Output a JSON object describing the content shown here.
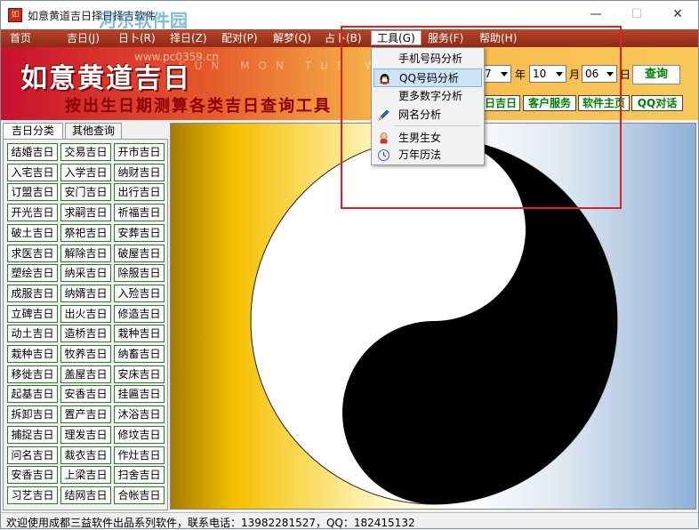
{
  "window": {
    "title": "如意黄道吉日择日择吉软件",
    "watermark": "河东软件园",
    "minimize": "—",
    "maximize": "☐",
    "close": "✕"
  },
  "menu": [
    {
      "label": "首页"
    },
    {
      "label": "吉日(J)"
    },
    {
      "label": "日卜(R)"
    },
    {
      "label": "择日(Z)"
    },
    {
      "label": "配对(P)"
    },
    {
      "label": "解梦(Q)"
    },
    {
      "label": "占卜(B)"
    },
    {
      "label": "工具(G)"
    },
    {
      "label": "服务(F)"
    },
    {
      "label": "帮助(H)"
    }
  ],
  "banner": {
    "title": "如意黄道吉日",
    "subtitle": "按出生日期测算各类吉日查询工具",
    "url": "www.pc0359.cn",
    "weekdays": "SUN MON TUE WED"
  },
  "date": {
    "year_value": "7",
    "year_label": "年",
    "month_value": "10",
    "month_label": "月",
    "day_value": "06",
    "day_label": "日",
    "query_button": "查询"
  },
  "links": {
    "jiri": "日吉日",
    "customer_service": "客户服务",
    "home": "软件主页",
    "qq": "QQ对话"
  },
  "tabs": {
    "jiri_category": "吉日分类",
    "other_query": "其他查询"
  },
  "jiri_buttons": [
    [
      "结婚吉日",
      "交易吉日",
      "开市吉日"
    ],
    [
      "入宅吉日",
      "入学吉日",
      "纳财吉日"
    ],
    [
      "订盟吉日",
      "安门吉日",
      "出行吉日"
    ],
    [
      "开光吉日",
      "求嗣吉日",
      "祈福吉日"
    ],
    [
      "破土吉日",
      "祭祀吉日",
      "安葬吉日"
    ],
    [
      "求医吉日",
      "解除吉日",
      "破屋吉日"
    ],
    [
      "塑绘吉日",
      "纳采吉日",
      "除服吉日"
    ],
    [
      "成服吉日",
      "纳婿吉日",
      "入殓吉日"
    ],
    [
      "立碑吉日",
      "出火吉日",
      "修造吉日"
    ],
    [
      "动土吉日",
      "造桥吉日",
      "栽种吉日"
    ],
    [
      "栽种吉日",
      "牧养吉日",
      "纳畜吉日"
    ],
    [
      "移徙吉日",
      "盖屋吉日",
      "安床吉日"
    ],
    [
      "起基吉日",
      "安香吉日",
      "挂匾吉日"
    ],
    [
      "拆卸吉日",
      "置产吉日",
      "沐浴吉日"
    ],
    [
      "捕捉吉日",
      "理发吉日",
      "修坟吉日"
    ],
    [
      "问名吉日",
      "裁衣吉日",
      "作灶吉日"
    ],
    [
      "安香吉日",
      "上梁吉日",
      "扫舍吉日"
    ],
    [
      "习艺吉日",
      "结网吉日",
      "合帐吉日"
    ]
  ],
  "tools_menu": {
    "items": [
      {
        "label": "手机号码分析",
        "icon": ""
      },
      {
        "label": "QQ号码分析",
        "icon": "qq-penguin-icon"
      },
      {
        "label": "更多数字分析",
        "icon": ""
      },
      {
        "label": "网名分析",
        "icon": "pen-icon"
      },
      {
        "label": "生男生女",
        "icon": "baby-icon"
      },
      {
        "label": "万年历法",
        "icon": "clock-icon"
      }
    ]
  },
  "status": {
    "text": "欢迎使用成都三益软件出品系列软件，联系电话：13982281527，QQ：182415132"
  },
  "colors": {
    "menubar": "#a8381f",
    "highlight": "#e02020",
    "button_text": "#008000"
  }
}
